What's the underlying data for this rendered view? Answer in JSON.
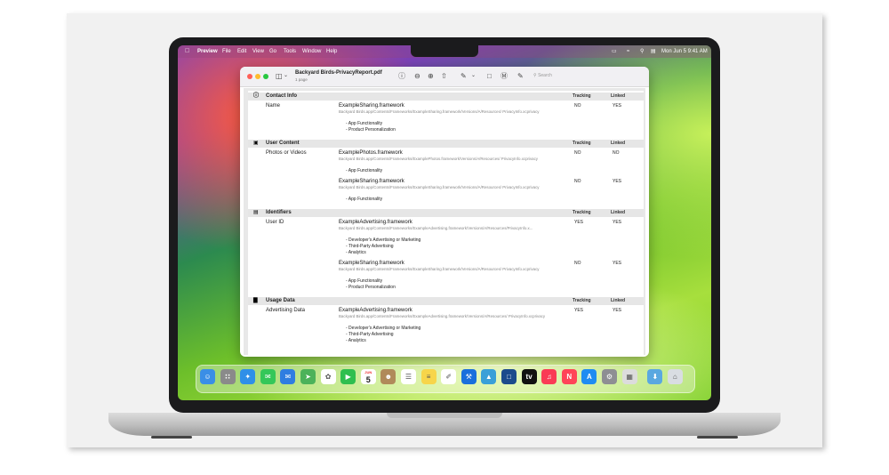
{
  "menubar": {
    "apple": "",
    "items": [
      "Preview",
      "File",
      "Edit",
      "View",
      "Go",
      "Tools",
      "Window",
      "Help"
    ],
    "clock": "Mon Jun 5  9:41 AM"
  },
  "window": {
    "title": "Backyard Birds-PrivacyReport.pdf",
    "subtitle": "1 page",
    "search_placeholder": "Search"
  },
  "report": {
    "tracking_header": "Tracking",
    "linked_header": "Linked",
    "sections": [
      {
        "icon": "info-icon",
        "title": "Contact Info",
        "rows": [
          {
            "label": "Name",
            "framework": "ExampleSharing.framework",
            "path": "Backyard Birds.app/Contents/Frameworks/ExampleSharing.framework/Versions/A/Resources/ PrivacyInfo.xcprivacy",
            "reasons": [
              "- App Functionality",
              "- Product Personalization"
            ],
            "tracking": "NO",
            "linked": "YES"
          }
        ]
      },
      {
        "icon": "photos-icon",
        "title": "User Content",
        "rows": [
          {
            "label": "Photos or Videos",
            "framework": "ExamplePhotos.framework",
            "path": "Backyard Birds.app/Contents/Frameworks/ExamplePhotos.framework/Versions/A/Resources/ PrivacyInfo.xcprivacy",
            "reasons": [
              "- App Functionality"
            ],
            "tracking": "NO",
            "linked": "NO"
          },
          {
            "label": "",
            "framework": "ExampleSharing.framework",
            "path": "Backyard Birds.app/Contents/Frameworks/ExampleSharing.framework/Versions/A/Resources/ PrivacyInfo.xcprivacy",
            "reasons": [
              "- App Functionality"
            ],
            "tracking": "NO",
            "linked": "YES"
          }
        ]
      },
      {
        "icon": "id-card-icon",
        "title": "Identifiers",
        "rows": [
          {
            "label": "User ID",
            "framework": "ExampleAdvertising.framework",
            "path": "Backyard Birds.app/Contents/Frameworks/ExampleAdvertising.framework/Versions/A/Resources/PrivacyInfo.x...",
            "reasons": [
              "- Developer's Advertising or Marketing",
              "- Third-Party Advertising",
              "- Analytics"
            ],
            "tracking": "YES",
            "linked": "YES"
          },
          {
            "label": "",
            "framework": "ExampleSharing.framework",
            "path": "Backyard Birds.app/Contents/Frameworks/ExampleSharing.framework/Versions/A/Resources/ PrivacyInfo.xcprivacy",
            "reasons": [
              "- App Functionality",
              "- Product Personalization"
            ],
            "tracking": "NO",
            "linked": "YES"
          }
        ]
      },
      {
        "icon": "bar-chart-icon",
        "title": "Usage Data",
        "rows": [
          {
            "label": "Advertising Data",
            "framework": "ExampleAdvertising.framework",
            "path": "Backyard Birds.app/Contents/Frameworks/ExampleAdvertising.framework/Versions/A/Resources/ PrivacyInfo.xcprivacy",
            "reasons": [
              "- Developer's Advertising or Marketing",
              "- Third-Party Advertising",
              "- Analytics"
            ],
            "tracking": "YES",
            "linked": "YES"
          }
        ]
      }
    ]
  },
  "dock": {
    "calendar_month": "JUN",
    "calendar_day": "5",
    "apps": [
      "finder-icon",
      "launchpad-icon",
      "safari-icon",
      "messages-icon",
      "mail-icon",
      "maps-icon",
      "photos-app-icon",
      "facetime-icon",
      "calendar-icon",
      "contacts-icon",
      "reminders-icon",
      "notes-icon",
      "freeform-icon",
      "xcode-icon",
      "instruments-icon",
      "simulator-icon",
      "appletv-icon",
      "music-icon",
      "news-icon",
      "appstore-icon",
      "system-settings-icon",
      "preview-app-icon",
      "downloads-folder-icon",
      "trash-icon"
    ],
    "colors": [
      "#3a8ee6",
      "#8a8a8a",
      "#2f8fe8",
      "#34c759",
      "#2f7de1",
      "#4cb25a",
      "#ffffff",
      "#2fbf4f",
      "#ffffff",
      "#b08a5a",
      "#ffffff",
      "#f7d54a",
      "#ffffff",
      "#1a6fdc",
      "#3aa0d8",
      "#1c4b8c",
      "#111111",
      "#fa3b55",
      "#ff4458",
      "#1f8cf2",
      "#8e8e93",
      "#dcdcdc",
      "#5aa8e0",
      "#d9dde2"
    ]
  }
}
